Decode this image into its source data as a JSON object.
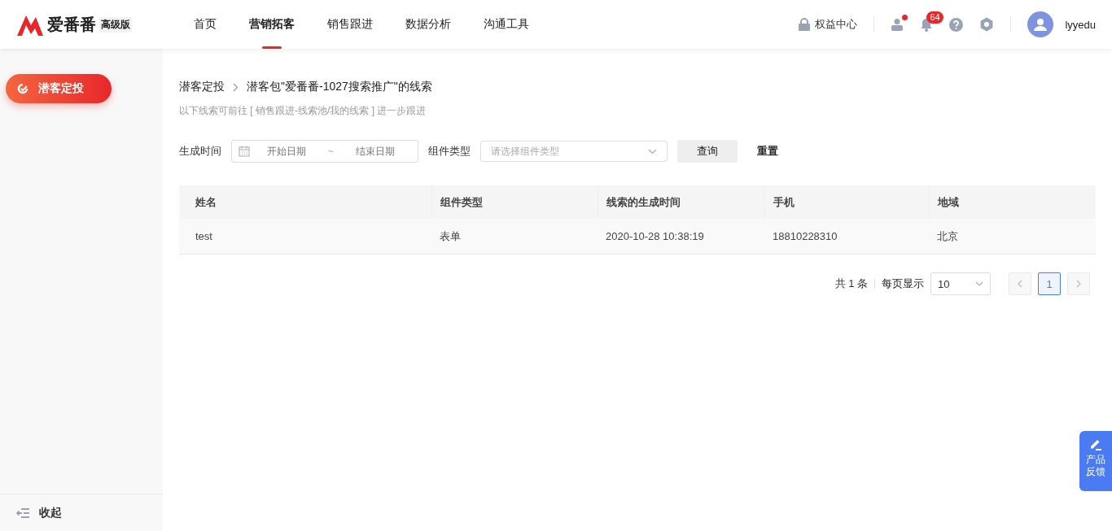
{
  "header": {
    "logo": "爱番番",
    "edition": "高级版",
    "nav": [
      {
        "label": "首页",
        "selected": false
      },
      {
        "label": "营销拓客",
        "selected": true
      },
      {
        "label": "销售跟进",
        "selected": false
      },
      {
        "label": "数据分析",
        "selected": false
      },
      {
        "label": "沟通工具",
        "selected": false
      }
    ],
    "rights": "权益中心",
    "notification_count": "64",
    "user": "lyyedu"
  },
  "sidebar": {
    "items": [
      {
        "label": "潜客定投",
        "selected": true
      }
    ],
    "collapse": "收起"
  },
  "breadcrumb": [
    "潜客定投",
    "潜客包\"爱番番-1027搜索推广\"的线索"
  ],
  "hint": "以下线索可前往 [ 销售跟进-线索池/我的线索 ] 进一步跟进",
  "filters": {
    "time_label": "生成时间",
    "start_placeholder": "开始日期",
    "separator": "~",
    "end_placeholder": "结束日期",
    "type_label": "组件类型",
    "type_placeholder": "请选择组件类型",
    "query": "查询",
    "reset": "重置"
  },
  "table": {
    "columns": [
      "姓名",
      "组件类型",
      "线索的生成时间",
      "手机",
      "地域"
    ],
    "rows": [
      [
        "test",
        "表单",
        "2020-10-28 10:38:19",
        "18810228310",
        "北京"
      ]
    ]
  },
  "pagination": {
    "total": "共 1 条",
    "page_size_label": "每页显示",
    "page_size": "10",
    "pages": [
      {
        "label": "1",
        "selected": true
      }
    ]
  },
  "feedback": "产品反馈"
}
